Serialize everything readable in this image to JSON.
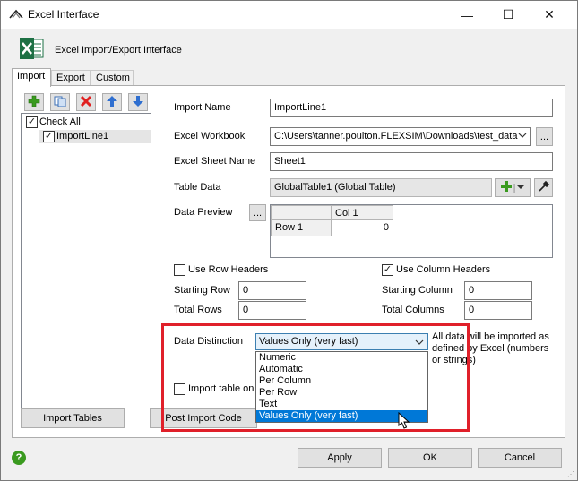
{
  "window": {
    "title": "Excel Interface",
    "controls": {
      "minimize": "—",
      "maximize": "☐",
      "close": "✕"
    }
  },
  "header": {
    "text": "Excel Import/Export Interface"
  },
  "tabs": [
    {
      "label": "Import",
      "active": true
    },
    {
      "label": "Export",
      "active": false
    },
    {
      "label": "Custom",
      "active": false
    }
  ],
  "toolbar": {
    "icons": [
      "add-icon",
      "copy-icon",
      "delete-icon",
      "move-up-icon",
      "move-down-icon"
    ]
  },
  "tree": {
    "items": [
      {
        "label": "Check All",
        "checked": true
      },
      {
        "label": "ImportLine1",
        "checked": true
      }
    ]
  },
  "form": {
    "import_name_label": "Import Name",
    "import_name_value": "ImportLine1",
    "workbook_label": "Excel Workbook",
    "workbook_value": "C:\\Users\\tanner.poulton.FLEXSIM\\Downloads\\test_data",
    "sheet_label": "Excel Sheet Name",
    "sheet_value": "Sheet1",
    "table_label": "Table Data",
    "table_value": "GlobalTable1 (Global Table)",
    "preview_label": "Data Preview",
    "ellipsis": "...",
    "preview": {
      "column_header": "Col 1",
      "row_header": "Row 1",
      "cell_value": "0"
    },
    "row_headers_label": "Use Row Headers",
    "row_headers_checked": false,
    "col_headers_label": "Use Column Headers",
    "col_headers_checked": true,
    "starting_row_label": "Starting Row",
    "starting_row_value": "0",
    "total_rows_label": "Total Rows",
    "total_rows_value": "0",
    "starting_col_label": "Starting Column",
    "starting_col_value": "0",
    "total_cols_label": "Total Columns",
    "total_cols_value": "0",
    "distinction_label": "Data Distinction",
    "distinction_value": "Values Only (very fast)",
    "distinction_options": [
      "Numeric",
      "Automatic",
      "Per Column",
      "Per Row",
      "Text",
      "Values Only (very fast)"
    ],
    "distinction_note": "All data will be imported as defined by Excel (numbers or strings)",
    "import_table_on_label": "Import table on",
    "import_table_on_checked": false
  },
  "buttons": {
    "import_tables": "Import Tables",
    "post_import": "Post Import Code",
    "apply": "Apply",
    "ok": "OK",
    "cancel": "Cancel",
    "help": "?"
  },
  "colors": {
    "highlight": "#e0202a",
    "selection": "#0078d7",
    "excel_green": "#1d7044"
  }
}
